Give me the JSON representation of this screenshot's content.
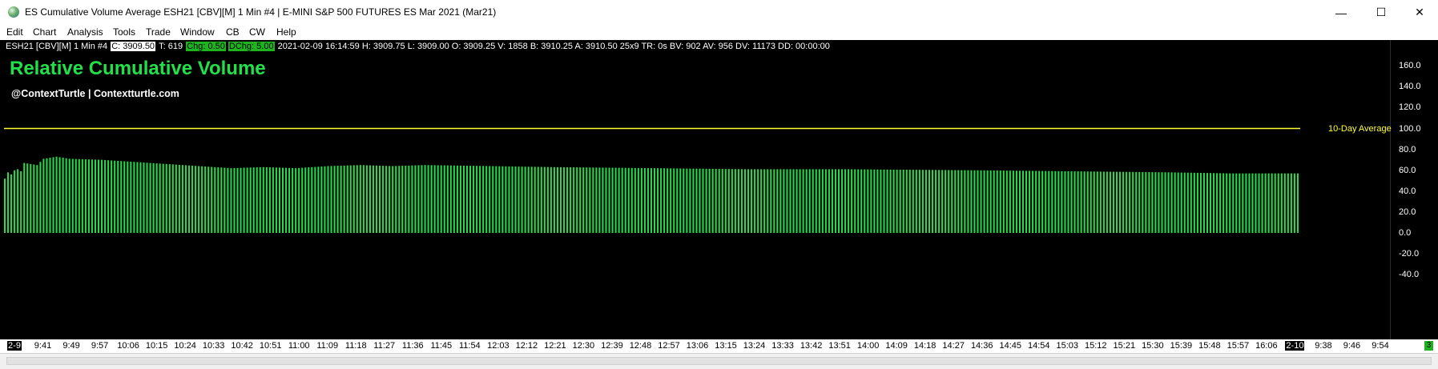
{
  "window": {
    "title": "ES Cumulative Volume Average ESH21 [CBV][M]  1 Min   #4 | E-MINI S&P 500 FUTURES ES Mar 2021 (Mar21)",
    "controls": {
      "minimize": "—",
      "maximize": "☐",
      "close": "✕"
    }
  },
  "menu": [
    "Edit",
    "Chart",
    "Analysis",
    "Tools",
    "Trade",
    "Window",
    "CB",
    "CW",
    "Help"
  ],
  "infobar": {
    "symbol": "ESH21 [CBV][M]  1 Min   #4",
    "close": "C: 3909.50",
    "ticks": "T: 619",
    "chg": "Chg: 0.50",
    "dchg": "DChg: 5.00",
    "rest": "2021-02-09 16:14:59 H: 3909.75 L: 3909.00 O: 3909.25 V: 1858 B: 3910.25 A: 3910.50 25x9 TR: 0s BV: 902 AV: 956 DV: 11173 DD: 00:00:00"
  },
  "chart_title": "Relative Cumulative Volume",
  "chart_subtitle": "@ContextTurtle | Contextturtle.com",
  "average_label": "10-Day Average",
  "status_indicator": "3",
  "colors": {
    "bars": "#22e04a",
    "average_line": "#ffff33",
    "background": "#000000"
  },
  "chart_data": {
    "type": "bar",
    "title": "Relative Cumulative Volume",
    "ylim": [
      -50,
      170
    ],
    "yticks": [
      160,
      140,
      120,
      100,
      80,
      60,
      40,
      20,
      0,
      -20,
      -40
    ],
    "ytick_labels": [
      "160.0",
      "140.0",
      "120.0",
      "100.0",
      "80.0",
      "60.0",
      "40.0",
      "20.0",
      "0.0",
      "-20.0",
      "-40.0"
    ],
    "reference_line": {
      "name": "10-Day Average",
      "value": 100
    },
    "x_labels": [
      "2-9",
      "9:41",
      "9:49",
      "9:57",
      "10:06",
      "10:15",
      "10:24",
      "10:33",
      "10:42",
      "10:51",
      "11:00",
      "11:09",
      "11:18",
      "11:27",
      "11:36",
      "11:45",
      "11:54",
      "12:03",
      "12:12",
      "12:21",
      "12:30",
      "12:39",
      "12:48",
      "12:57",
      "13:06",
      "13:15",
      "13:24",
      "13:33",
      "13:42",
      "13:51",
      "14:00",
      "14:09",
      "14:18",
      "14:27",
      "14:36",
      "14:45",
      "14:54",
      "15:03",
      "15:12",
      "15:21",
      "15:30",
      "15:39",
      "15:48",
      "15:57",
      "16:06",
      "2-10",
      "9:38",
      "9:46",
      "9:54"
    ],
    "bar_count": 401,
    "keyframes": [
      [
        0,
        52
      ],
      [
        1,
        58
      ],
      [
        2,
        56
      ],
      [
        3,
        60
      ],
      [
        4,
        61
      ],
      [
        5,
        59
      ],
      [
        6,
        67
      ],
      [
        10,
        65
      ],
      [
        12,
        71
      ],
      [
        16,
        73
      ],
      [
        20,
        71
      ],
      [
        30,
        70
      ],
      [
        40,
        68
      ],
      [
        50,
        66
      ],
      [
        60,
        64
      ],
      [
        70,
        62
      ],
      [
        80,
        63
      ],
      [
        90,
        62
      ],
      [
        100,
        64
      ],
      [
        110,
        65
      ],
      [
        120,
        64
      ],
      [
        130,
        65
      ],
      [
        150,
        64
      ],
      [
        170,
        63
      ],
      [
        200,
        62
      ],
      [
        230,
        61
      ],
      [
        260,
        61
      ],
      [
        300,
        60
      ],
      [
        330,
        59
      ],
      [
        360,
        58
      ],
      [
        380,
        57
      ],
      [
        400,
        57
      ]
    ]
  }
}
